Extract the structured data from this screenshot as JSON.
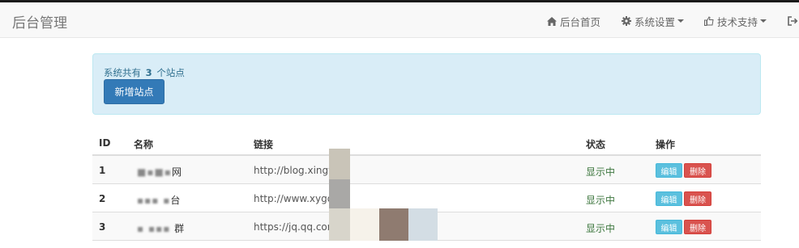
{
  "navbar": {
    "brand": "后台管理",
    "items": [
      {
        "label": "后台首页",
        "icon": "home-icon"
      },
      {
        "label": "系统设置",
        "icon": "gear-icon",
        "dropdown": true
      },
      {
        "label": "技术支持",
        "icon": "thumbs-up-icon",
        "dropdown": true
      },
      {
        "label": "",
        "icon": "logout-icon"
      }
    ]
  },
  "alert": {
    "prefix": "系统共有",
    "count": "3",
    "suffix": "个站点",
    "add_button": "新增站点"
  },
  "table": {
    "headers": [
      "ID",
      "名称",
      "链接",
      "状态",
      "操作"
    ],
    "rows": [
      {
        "id": "1",
        "name": "网",
        "link": "http://blog.xingyi",
        "status": "显示中"
      },
      {
        "id": "2",
        "name": "台",
        "link": "http://www.xygds",
        "status": "显示中"
      },
      {
        "id": "3",
        "name": "群",
        "link": "https://jq.qq.com",
        "status": "显示中"
      }
    ],
    "edit_label": "编辑",
    "delete_label": "删除"
  },
  "colors": {
    "primary": "#337ab7",
    "info_bg": "#d9edf7",
    "success_text": "#3c763d",
    "edit_btn": "#5bc0de",
    "delete_btn": "#d9534f"
  }
}
